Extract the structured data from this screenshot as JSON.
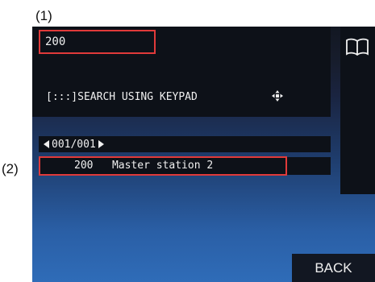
{
  "callouts": {
    "label_1": "(1)",
    "label_2": "(2)"
  },
  "input": {
    "value": "200"
  },
  "search": {
    "label": "[:::]SEARCH USING KEYPAD"
  },
  "pager": {
    "text": "001/001"
  },
  "result": {
    "number": "200",
    "name": "Master station 2"
  },
  "buttons": {
    "back": "BACK"
  },
  "icons": [
    "book-icon",
    "move-icon",
    "arrow-left-icon",
    "arrow-right-icon"
  ],
  "colors": {
    "highlight": "#e03a3a",
    "panel": "#0d1118"
  }
}
